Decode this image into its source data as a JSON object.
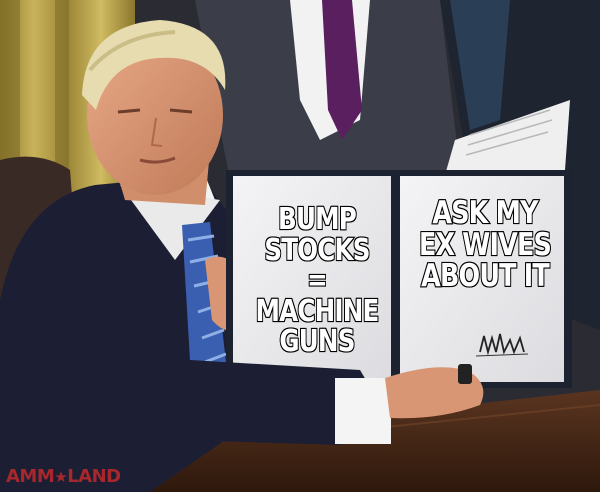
{
  "meme": {
    "left_document_text": "BUMP\nSTOCKS\n= MACHINE\nGUNS",
    "right_document_text": "ASK MY\nEX WIVES\nABOUT IT"
  },
  "watermark": {
    "prefix": "AMM",
    "star": "★",
    "suffix": "LAND"
  },
  "colors": {
    "watermark_red": "#c0292d",
    "suit": "#1c1f33",
    "tie": "#3b5fb0",
    "desk": "#4a2a18",
    "curtain": "#b8a24a"
  }
}
